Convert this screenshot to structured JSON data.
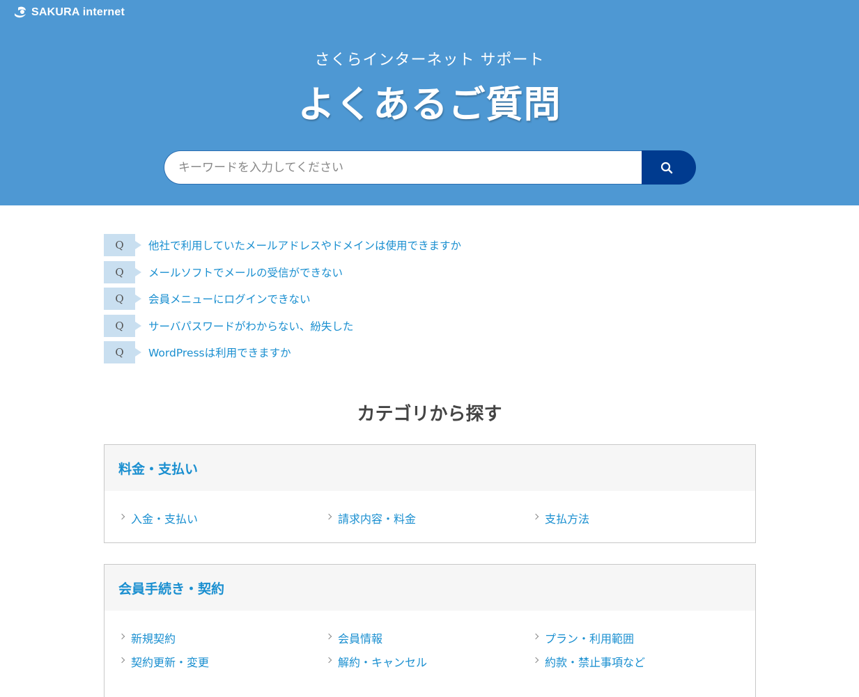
{
  "header": {
    "logo_text": "SAKURA internet",
    "subtitle": "さくらインターネット サポート",
    "title": "よくあるご質問"
  },
  "search": {
    "placeholder": "キーワードを入力してください",
    "value": ""
  },
  "faq": {
    "badge": "Q",
    "items": [
      "他社で利用していたメールアドレスやドメインは使用できますか",
      "メールソフトでメールの受信ができない",
      "会員メニューにログインできない",
      "サーバパスワードがわからない、紛失した",
      "WordPressは利用できますか"
    ]
  },
  "categories_heading": "カテゴリから探す",
  "categories": [
    {
      "title": "料金・支払い",
      "links": [
        "入金・支払い",
        "請求内容・料金",
        "支払方法"
      ]
    },
    {
      "title": "会員手続き・契約",
      "links": [
        "新規契約",
        "会員情報",
        "プラン・利用範囲",
        "契約更新・変更",
        "解約・キャンセル",
        "約款・禁止事項など"
      ]
    }
  ],
  "colors": {
    "hero_bg": "#4e98d3",
    "search_button": "#003b8f",
    "link": "#1a8fd0",
    "q_badge": "#c9dff0"
  }
}
